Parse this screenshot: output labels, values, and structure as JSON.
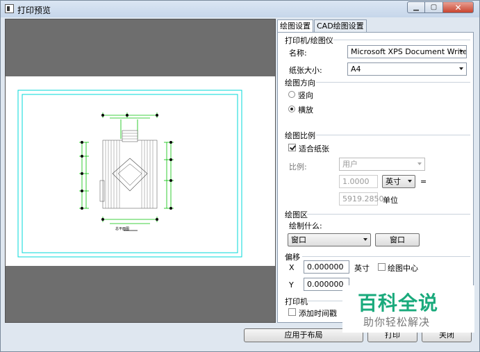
{
  "window": {
    "title": "打印预览"
  },
  "tabs": [
    {
      "label": "绘图设置"
    },
    {
      "label": "CAD绘图设置"
    }
  ],
  "printer_group": {
    "title": "打印机/绘图仪",
    "name_label": "名称:",
    "name_value": "Microsoft XPS Document Writer",
    "paper_label": "纸张大小:",
    "paper_value": "A4"
  },
  "orientation_group": {
    "title": "绘图方向",
    "portrait": "竖向",
    "landscape": "横放"
  },
  "scale_group": {
    "title": "绘图比例",
    "fit_paper": "适合纸张",
    "scale_label": "比例:",
    "scale_combo": "用户",
    "value1": "1.0000",
    "unit_combo": "英寸",
    "equals": "=",
    "value2": "5919.2850",
    "unit_label": "单位"
  },
  "area_group": {
    "title": "绘图区",
    "what_label": "绘制什么:",
    "what_value": "窗口",
    "window_button": "窗口"
  },
  "offset_group": {
    "title": "偏移",
    "x_label": "X",
    "x_value": "0.000000",
    "x_unit": "英寸",
    "center_label": "绘图中心",
    "y_label": "Y",
    "y_value": "0.000000"
  },
  "plot_group": {
    "title": "打印机",
    "timestamp_label": "添加时间戳"
  },
  "bottom": {
    "apply_layout": "应用于布局",
    "print": "打印",
    "close": "关闭"
  },
  "watermark": {
    "title": "百科全说",
    "subtitle": "助你轻松解决"
  },
  "drawing": {
    "caption": "总平面图"
  },
  "colors": {
    "cad_green": "#00c000",
    "cad_cyan": "#00d8d8",
    "watermark_green": "#1aaa7c"
  },
  "icons": {
    "window": "app-window-icon",
    "minimize": "minimize-icon",
    "maximize": "maximize-icon",
    "close": "close-icon"
  }
}
